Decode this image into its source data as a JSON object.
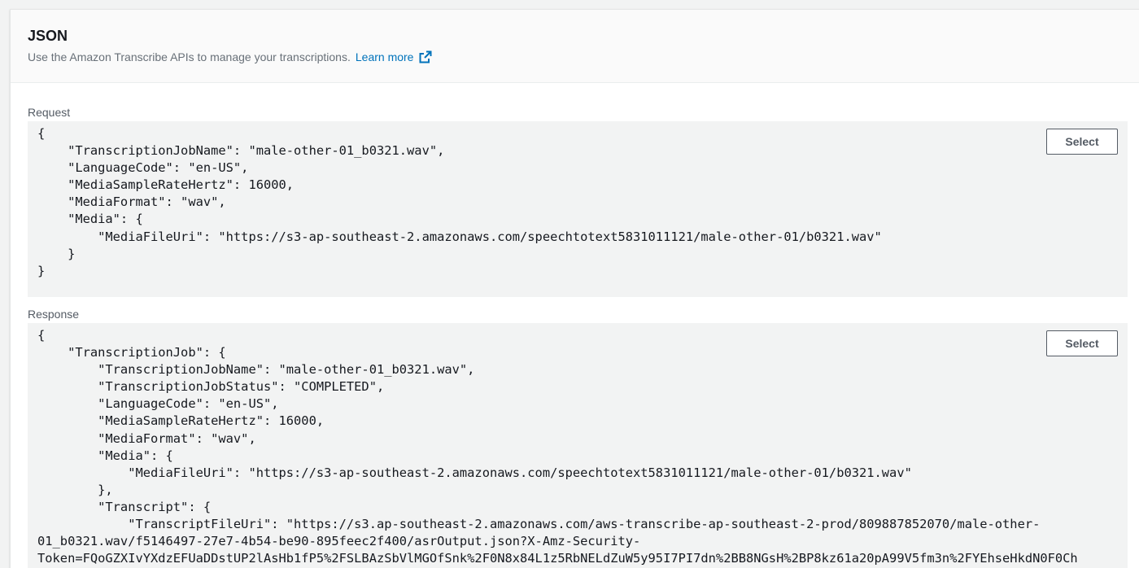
{
  "panel": {
    "title": "JSON",
    "description": "Use the Amazon Transcribe APIs to manage your transcriptions.",
    "learn_more": "Learn more"
  },
  "request": {
    "label": "Request",
    "select_label": "Select",
    "lines": [
      "{",
      "    \"TranscriptionJobName\": \"male-other-01_b0321.wav\",",
      "    \"LanguageCode\": \"en-US\",",
      "    \"MediaSampleRateHertz\": 16000,",
      "    \"MediaFormat\": \"wav\",",
      "    \"Media\": {",
      "        \"MediaFileUri\": \"https://s3-ap-southeast-2.amazonaws.com/speechtotext5831011121/male-other-01/b0321.wav\"",
      "    }",
      "}"
    ]
  },
  "response": {
    "label": "Response",
    "select_label": "Select",
    "lines": [
      "{",
      "    \"TranscriptionJob\": {",
      "        \"TranscriptionJobName\": \"male-other-01_b0321.wav\",",
      "        \"TranscriptionJobStatus\": \"COMPLETED\",",
      "        \"LanguageCode\": \"en-US\",",
      "        \"MediaSampleRateHertz\": 16000,",
      "        \"MediaFormat\": \"wav\",",
      "        \"Media\": {",
      "            \"MediaFileUri\": \"https://s3-ap-southeast-2.amazonaws.com/speechtotext5831011121/male-other-01/b0321.wav\"",
      "        },",
      "        \"Transcript\": {",
      "            \"TranscriptFileUri\": \"https://s3.ap-southeast-2.amazonaws.com/aws-transcribe-ap-southeast-2-prod/809887852070/male-other-",
      "01_b0321.wav/f5146497-27e7-4b54-be90-895feec2f400/asrOutput.json?X-Amz-Security-",
      "Token=FQoGZXIvYXdzEFUaDDstUP2lAsHb1fP5%2FSLBAzSbVlMGOfSnk%2F0N8x84L1z5RbNELdZuW5y95I7PI7dn%2BB8NGsH%2BP8kz61a20pA99V5fm3n%2FYEhseHkdN0F0Ch"
    ]
  },
  "colors": {
    "link": "#0073bb",
    "code_bg": "#f2f3f3",
    "button_border": "#545b64"
  }
}
